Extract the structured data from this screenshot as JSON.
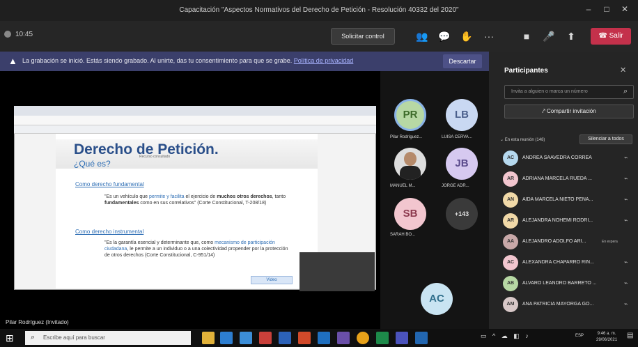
{
  "window": {
    "title": "Capacitación \"Aspectos Normativos del Derecho de Petición - Resolución 40332 del 2020\"",
    "minimize": "–",
    "maximize": "□",
    "close": "✕"
  },
  "toolbar": {
    "timer": "10:45",
    "request_control": "Solicitar control",
    "leave": "Salir",
    "more": "···"
  },
  "banner": {
    "text": "La grabación se inició. Estás siendo grabado. Al unirte, das tu consentimiento para que se grabe.",
    "link": "Política de privacidad",
    "discard": "Descartar"
  },
  "slide": {
    "title": "Derecho de Petición.",
    "subtitle": "Recurso consultado",
    "question": "¿Qué es?",
    "heading1": "Como derecho fundamental",
    "p1_a": "\"Es un vehículo que ",
    "p1_hl1": "permite y facilita",
    "p1_b": " el ejercicio de ",
    "p1_hl2": "muchos otros derechos",
    "p1_c": ", tanto ",
    "p1_hl3": "fundamentales",
    "p1_d": " como en sus correlativos\" (Corte Constitucional, T-208/18)",
    "heading2": "Como derecho instrumental",
    "p2_a": "\"Es la garantía esencial y determinante que, como ",
    "p2_hl1": "mecanismo de participación ciudadana",
    "p2_b": ", le permite a un individuo o a una colectividad propender por la protección de otros derechos (Corte Constitucional, C-951/14)",
    "button": "Video"
  },
  "presenter_label": "Pilar Rodríguez (Invitado)",
  "tiles": [
    {
      "initials": "PR",
      "name": "Pilar Rodríguez...",
      "bg": "#b7d8a4",
      "fg": "#3d6b2a"
    },
    {
      "initials": "LB",
      "name": "LUISA CERVA...",
      "bg": "#c9d8f2",
      "fg": "#4a5f8c"
    },
    {
      "initials": "",
      "name": "MANUEL M...",
      "bg": "#dddddd",
      "fg": "#333333"
    },
    {
      "initials": "JB",
      "name": "JORGE ADR...",
      "bg": "#d6c9f0",
      "fg": "#5a4a8c"
    },
    {
      "initials": "SB",
      "name": "SARAH BO...",
      "bg": "#f2c6cf",
      "fg": "#8c3a4f"
    },
    {
      "initials": "+143",
      "name": "",
      "bg": "#3a3a3a",
      "fg": "#dddddd"
    },
    {
      "initials": "AC",
      "name": "",
      "bg": "#c9e4f2",
      "fg": "#2f6f8c"
    }
  ],
  "panel": {
    "title": "Participantes",
    "invite_placeholder": "Invita a alguien o marca un número",
    "share_invite": "Compartir invitación",
    "meeting_label": "En esta reunión (148)",
    "mute_all": "Silenciar a todos",
    "participants": [
      {
        "initials": "AC",
        "name": "ANDREA SAAVEDRA CORREA",
        "status": "",
        "color": "#b6d9ef"
      },
      {
        "initials": "AR",
        "name": "ADRIANA MARCELA RUEDA ...",
        "status": "",
        "color": "#f2c6cf"
      },
      {
        "initials": "AN",
        "name": "AIDA MARCELA NIETO PENA...",
        "status": "",
        "color": "#f1d9a8"
      },
      {
        "initials": "AR",
        "name": "ALEJANDRA NOHEMI RODRI...",
        "status": "",
        "color": "#f1d9a8"
      },
      {
        "initials": "AA",
        "name": "ALEJANDRO ADOLFO ARI...",
        "status": "En espera",
        "color": "#c8a8a8"
      },
      {
        "initials": "AC",
        "name": "ALEXANDRA CHAPARRO RIN...",
        "status": "",
        "color": "#f2c6cf"
      },
      {
        "initials": "AB",
        "name": "ALVARO LEANDRO BARRETO ...",
        "status": "",
        "color": "#b7d8a4"
      },
      {
        "initials": "AM",
        "name": "ANA PATRICIA MAYORGA GO...",
        "status": "",
        "color": "#d8c8c8"
      }
    ]
  },
  "taskbar": {
    "search_placeholder": "Escribe aquí para buscar",
    "lang": "ESP",
    "time": "9:46 a. m.",
    "date": "29/06/2021"
  },
  "colors": {
    "leave": "#c4314b",
    "banner": "#3b3f6b",
    "slide_title": "#2a4f8a"
  }
}
